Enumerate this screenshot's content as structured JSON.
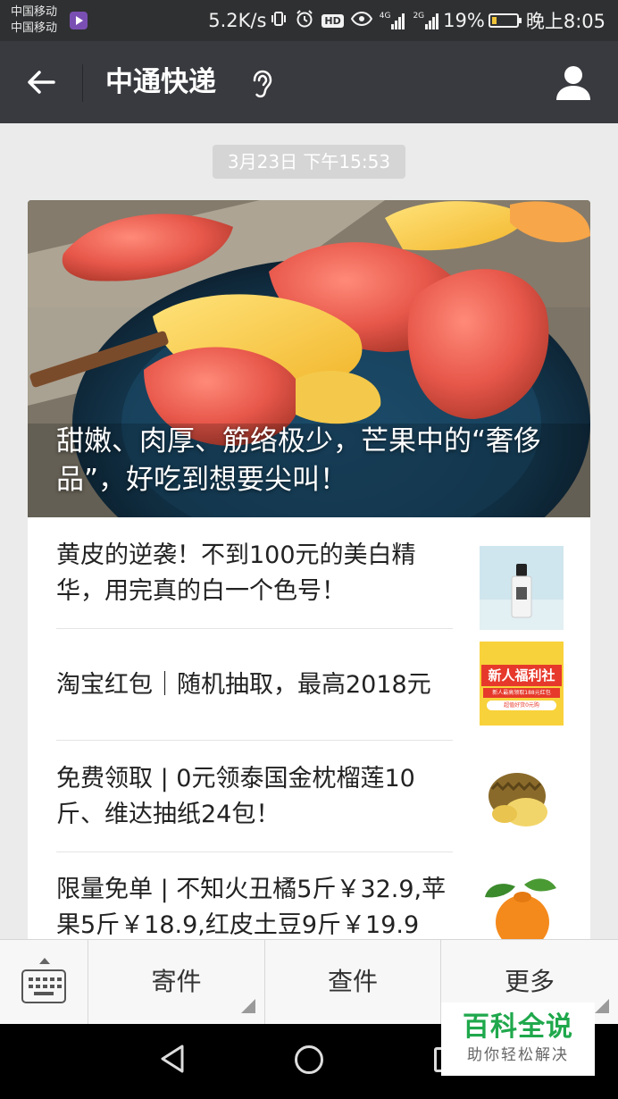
{
  "status_bar": {
    "carrier_1": "中国移动",
    "carrier_2": "中国移动",
    "net_speed": "5.2K/s",
    "hd_badge": "HD",
    "net_4g": "4G",
    "net_2g": "2G",
    "battery": "19%",
    "time": "晚上8:05",
    "battery_level": 0.19,
    "icons": [
      "video-app-icon",
      "vibrate-icon",
      "alarm-icon",
      "hd-icon",
      "eye-icon",
      "signal-4g-icon",
      "signal-2g-icon",
      "battery-icon"
    ]
  },
  "title_bar": {
    "title": "中通快递",
    "icons": [
      "back-arrow-icon",
      "ear-icon",
      "profile-icon"
    ]
  },
  "timestamp": "3月23日 下午15:53",
  "article": {
    "cover_title": "甜嫩、肉厚、筋络极少，芒果中的“奢侈品”，好吃到想要尖叫！",
    "items": [
      {
        "title": "黄皮的逆袭！不到100元的美白精华，用完真的白一个色号！"
      },
      {
        "title": "淘宝红包｜随机抽取，最高2018元",
        "thumb_text_1": "新人福利社",
        "thumb_text_2": "新人最高领取188元红包",
        "thumb_text_3": "超值好货0元购"
      },
      {
        "title": "免费领取 | 0元领泰国金枕榴莲10斤、维达抽纸24包！"
      },
      {
        "title": "限量免单 | 不知火丑橘5斤￥32.9,苹果5斤￥18.9,红皮土豆9斤￥19.9"
      }
    ]
  },
  "menu": {
    "items": [
      "寄件",
      "查件",
      "更多"
    ],
    "icons": [
      "keyboard-icon"
    ]
  },
  "nav": {
    "icons": [
      "nav-back-icon",
      "nav-home-icon",
      "nav-recent-icon"
    ]
  },
  "watermark": {
    "title": "百科全说",
    "subtitle": "助你轻松解决"
  },
  "colors": {
    "status_bg": "#2f3032",
    "titlebar_bg": "#393a3f",
    "page_bg": "#ebebeb",
    "watermark_green": "#1fa84c"
  }
}
